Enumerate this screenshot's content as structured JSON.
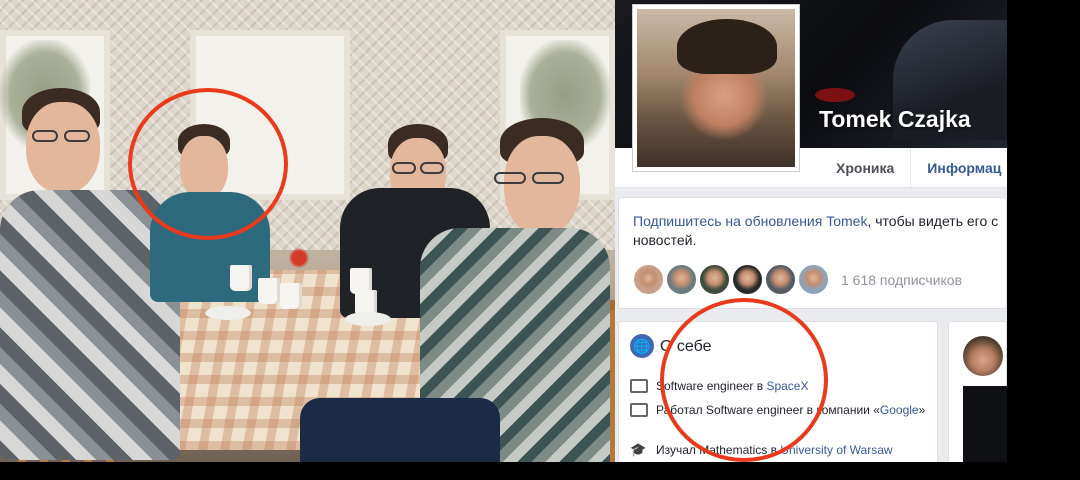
{
  "profile": {
    "name": "Tomek Czajka",
    "tabs": [
      {
        "label": "Хроника"
      },
      {
        "label": "Информац"
      }
    ]
  },
  "follow": {
    "link_prefix": "Подпишитесь на обновления ",
    "link_name": "Tomek",
    "suffix": ", чтобы видеть его с",
    "second_line": "новостей.",
    "followers_count": "1 618 подписчиков",
    "follower_avatar_colors": [
      "#c9a18b",
      "#6b7b7f",
      "#3e4a3c",
      "#2a2a2a",
      "#555b62",
      "#8fa3b8"
    ]
  },
  "about": {
    "title": "О себе",
    "rows": [
      {
        "icon": "briefcase-icon",
        "text": "Software engineer в ",
        "link": "SpaceX",
        "tail": ""
      },
      {
        "icon": "briefcase-icon",
        "text": "Работал Software engineer в компании «",
        "link": "Google",
        "tail": "»"
      },
      {
        "icon": "graduation-cap-icon",
        "text": "Изучал Mathematics в ",
        "link": "University of Warsaw",
        "tail": ""
      }
    ]
  },
  "colors": {
    "annotation_circle": "#ea3a1c",
    "link": "#365899",
    "background": "#e9ebee"
  }
}
